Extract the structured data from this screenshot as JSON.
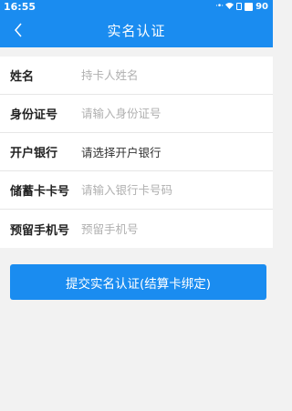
{
  "status_bar": {
    "time": "16:55",
    "battery": "90",
    "icons": [
      "signal-dots-icon",
      "wifi-icon",
      "sim-icon",
      "battery-icon"
    ]
  },
  "header": {
    "title": "实名认证",
    "back_icon": "chevron-left-icon",
    "color": "#1a8cf0"
  },
  "form": {
    "fields": [
      {
        "label": "姓名",
        "placeholder": "持卡人姓名",
        "value": ""
      },
      {
        "label": "身份证号",
        "placeholder": "请输入身份证号",
        "value": ""
      },
      {
        "label": "开户银行",
        "value": "请选择开户银行"
      },
      {
        "label": "储蓄卡卡号",
        "placeholder": "请输入银行卡号码",
        "value": ""
      },
      {
        "label": "预留手机号",
        "placeholder": "预留手机号",
        "value": ""
      }
    ]
  },
  "submit_button": {
    "label": "提交实名认证(结算卡绑定)",
    "color": "#1a8cf0"
  }
}
